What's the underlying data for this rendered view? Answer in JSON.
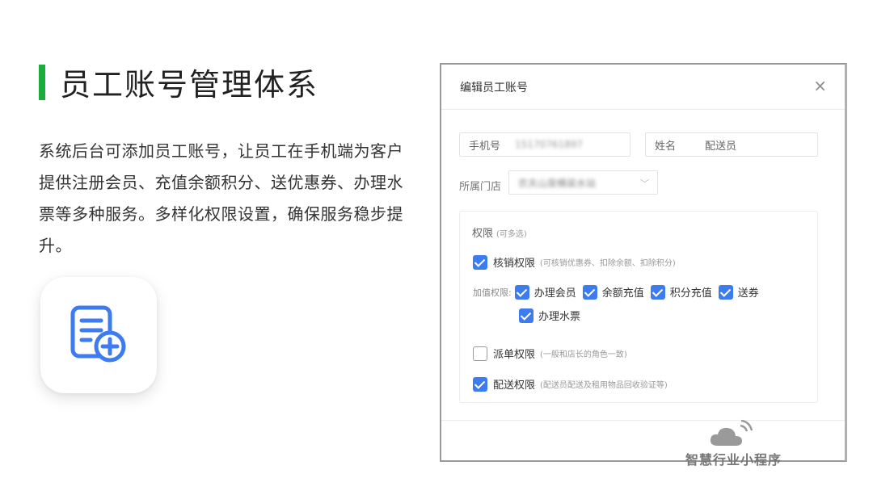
{
  "heading": {
    "title": "员工账号管理体系",
    "accent_color": "#1aad3b"
  },
  "description": "系统后台可添加员工账号，让员工在手机端为客户提供注册会员、充值余额积分、送优惠券、办理水票等多种服务。多样化权限设置，确保服务稳步提升。",
  "app_icon": {
    "name": "document-add-icon",
    "color": "#3d7bf0"
  },
  "dialog": {
    "title": "编辑员工账号",
    "close_label": "×",
    "phone": {
      "label": "手机号",
      "value": "15170761897"
    },
    "name": {
      "label": "姓名",
      "value": "配送员"
    },
    "store": {
      "label": "所属门店",
      "value": "农夫山泉桶装水站"
    },
    "permissions": {
      "title": "权限",
      "hint": "(可多选)",
      "writeoff": {
        "label": "核销权限",
        "note": "(可核销优惠券、扣除余额、扣除积分)",
        "checked": true
      },
      "add_value": {
        "label": "加值权限:",
        "items": [
          {
            "label": "办理会员",
            "checked": true
          },
          {
            "label": "余额充值",
            "checked": true
          },
          {
            "label": "积分充值",
            "checked": true
          },
          {
            "label": "送券",
            "checked": true
          },
          {
            "label": "办理水票",
            "checked": true
          }
        ]
      },
      "dispatch": {
        "label": "派单权限",
        "note": "(一般和店长的角色一致)",
        "checked": false
      },
      "delivery": {
        "label": "配送权限",
        "note": "(配送员配送及租用物品回收验证等)",
        "checked": true
      }
    }
  },
  "watermark": {
    "text": "智慧行业小程序",
    "icon": "cloud-signal-icon"
  }
}
